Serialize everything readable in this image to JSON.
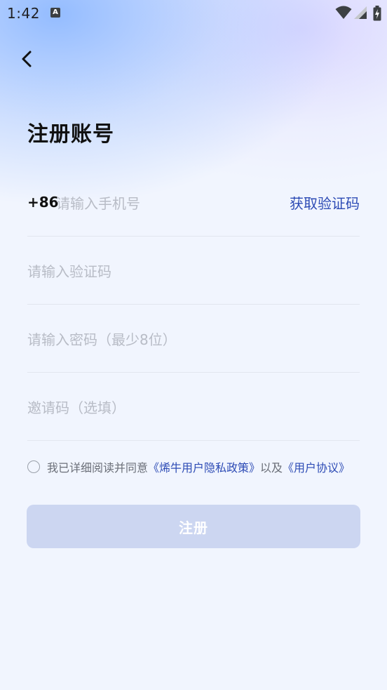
{
  "status_bar": {
    "time": "1:42",
    "notification_icon": "A"
  },
  "nav": {
    "back_icon": "chevron-left-icon"
  },
  "page": {
    "title": "注册账号"
  },
  "form": {
    "phone": {
      "prefix": "+86",
      "placeholder": "请输入手机号",
      "get_code_label": "获取验证码"
    },
    "code": {
      "placeholder": "请输入验证码"
    },
    "password": {
      "placeholder": "请输入密码（最少8位）"
    },
    "invite": {
      "placeholder": "邀请码（选填）"
    }
  },
  "agreement": {
    "prefix": "我已详细阅读并同意",
    "privacy_link": "《烯牛用户隐私政策》",
    "connector": "以及",
    "terms_link": "《用户协议》",
    "checked": false
  },
  "register_button": {
    "label": "注册"
  },
  "colors": {
    "accent": "#2d4bb5",
    "button_disabled": "#ccd6f1",
    "placeholder": "#b8bcc6"
  }
}
